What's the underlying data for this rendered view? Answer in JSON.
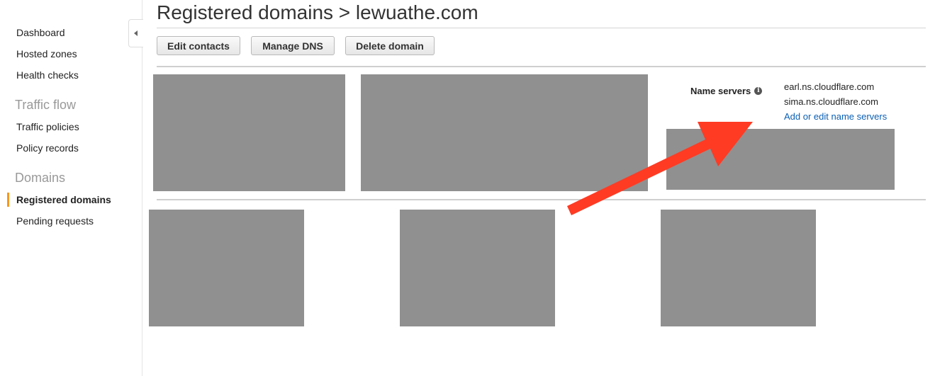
{
  "sidebar": {
    "items": [
      {
        "label": "Dashboard"
      },
      {
        "label": "Hosted zones"
      },
      {
        "label": "Health checks"
      }
    ],
    "sections": [
      {
        "title": "Traffic flow",
        "items": [
          {
            "label": "Traffic policies"
          },
          {
            "label": "Policy records"
          }
        ]
      },
      {
        "title": "Domains",
        "items": [
          {
            "label": "Registered domains",
            "active": true
          },
          {
            "label": "Pending requests"
          }
        ]
      }
    ],
    "accent_color": "#f7981d"
  },
  "main": {
    "title": "Registered domains > lewuathe.com",
    "buttons": {
      "edit_contacts": "Edit contacts",
      "manage_dns": "Manage DNS",
      "delete_domain": "Delete domain"
    },
    "name_servers": {
      "label": "Name servers",
      "values": [
        "earl.ns.cloudflare.com",
        "sima.ns.cloudflare.com"
      ],
      "edit_link": "Add or edit name servers"
    }
  },
  "colors": {
    "redaction": "#909090",
    "annotation_arrow": "#ff3b24",
    "link": "#0b5fb3"
  },
  "icons": {
    "collapse": "caret-left-icon",
    "info": "info-icon"
  }
}
